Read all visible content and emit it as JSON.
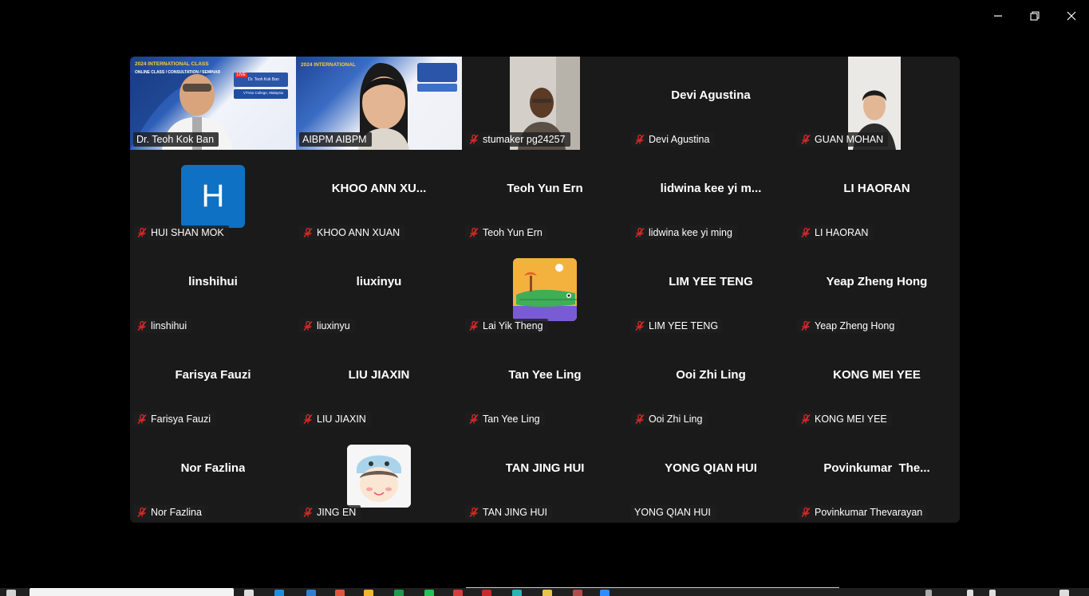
{
  "window": {
    "controls": [
      "minimize",
      "restore",
      "close"
    ]
  },
  "colors": {
    "grid_bg": "#1a1a1a",
    "active_border": "#23d959",
    "mute_red": "#e02828",
    "avatar_blue": "#0e71c3"
  },
  "participants": [
    {
      "display": "",
      "tag": "Dr. Teoh Kok Ban",
      "muted": false,
      "kind": "video-teoh"
    },
    {
      "display": "",
      "tag": "AIBPM AIBPM",
      "muted": false,
      "kind": "video-aibpm",
      "active": true
    },
    {
      "display": "",
      "tag": "stumaker pg24257",
      "muted": true,
      "kind": "video-stumaker"
    },
    {
      "display": "Devi Agustina",
      "tag": "Devi Agustina",
      "muted": true
    },
    {
      "display": "",
      "tag": "GUAN MOHAN",
      "muted": true,
      "kind": "video-guan"
    },
    {
      "display": "",
      "tag": "HUI SHAN MOK",
      "muted": true,
      "kind": "avatar-letter",
      "letter": "H"
    },
    {
      "display": "KHOO ANN XU...",
      "tag": "KHOO ANN XUAN",
      "muted": true
    },
    {
      "display": "Teoh Yun Ern",
      "tag": "Teoh Yun Ern",
      "muted": true
    },
    {
      "display": "lidwina kee yi m...",
      "tag": "lidwina kee yi ming",
      "muted": true
    },
    {
      "display": "LI HAORAN",
      "tag": "LI HAORAN",
      "muted": true
    },
    {
      "display": "linshihui",
      "tag": "linshihui",
      "muted": true
    },
    {
      "display": "liuxinyu",
      "tag": "liuxinyu",
      "muted": true
    },
    {
      "display": "",
      "tag": "Lai Yik Theng",
      "muted": true,
      "kind": "avatar-croc"
    },
    {
      "display": "LIM YEE TENG",
      "tag": "LIM YEE TENG",
      "muted": true
    },
    {
      "display": "Yeap Zheng Hong",
      "tag": "Yeap Zheng Hong",
      "muted": true
    },
    {
      "display": "Farisya Fauzi",
      "tag": "Farisya Fauzi",
      "muted": true
    },
    {
      "display": "LIU JIAXIN",
      "tag": "LIU JIAXIN",
      "muted": true
    },
    {
      "display": "Tan Yee Ling",
      "tag": "Tan Yee Ling",
      "muted": true
    },
    {
      "display": "Ooi Zhi Ling",
      "tag": "Ooi Zhi Ling",
      "muted": true
    },
    {
      "display": "KONG MEI YEE",
      "tag": "KONG MEI YEE",
      "muted": true
    },
    {
      "display": "Nor Fazlina",
      "tag": "Nor Fazlina",
      "muted": true
    },
    {
      "display": "",
      "tag": "JING EN",
      "muted": true,
      "kind": "avatar-cartoon"
    },
    {
      "display": "TAN JING HUI",
      "tag": "TAN JING HUI",
      "muted": true
    },
    {
      "display": "YONG QIAN HUI",
      "tag": "YONG QIAN HUI",
      "muted": false
    },
    {
      "display": "Povinkumar  The...",
      "tag": "Povinkumar Thevarayan",
      "muted": true
    }
  ],
  "slide_text": {
    "teoh_banner": "2024 INTERNATIONAL CLASS",
    "teoh_sub": "ONLINE CLASS / CONSULTATION / SEMINAR",
    "teoh_card_name": "Dr. Teoh Kok Ban",
    "teoh_card_org": "VTVox College, Malaysia",
    "aibpm_banner": "2024 INTERNATIONAL",
    "live": "LIVE"
  }
}
